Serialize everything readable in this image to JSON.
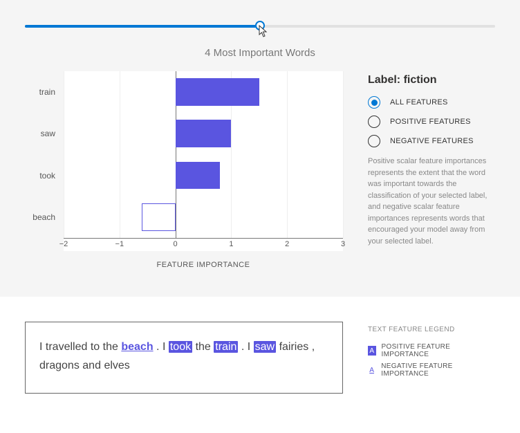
{
  "slider": {
    "percent": 50
  },
  "title": "4 Most Important Words",
  "chart_data": {
    "type": "bar",
    "orientation": "horizontal",
    "title": "4 Most Important Words",
    "xlabel": "FEATURE IMPORTANCE",
    "ylabel": "",
    "xlim": [
      -2,
      3
    ],
    "xticks": [
      -2,
      -1,
      0,
      1,
      2,
      3
    ],
    "categories": [
      "train",
      "saw",
      "took",
      "beach"
    ],
    "values": [
      1.5,
      1.0,
      0.8,
      -0.6
    ],
    "series": [
      {
        "name": "Feature Importance",
        "values": [
          1.5,
          1.0,
          0.8,
          -0.6
        ]
      }
    ]
  },
  "side": {
    "title": "Label: fiction",
    "options": [
      {
        "label": "ALL FEATURES",
        "selected": true
      },
      {
        "label": "POSITIVE FEATURES",
        "selected": false
      },
      {
        "label": "NEGATIVE FEATURES",
        "selected": false
      }
    ],
    "description": "Positive scalar feature importances represents the extent that the word was important towards the classification of your selected label, and negative scalar feature importances represents words that encouraged your model away from your selected label."
  },
  "sentence": {
    "tokens": [
      {
        "text": "I",
        "kind": "plain"
      },
      {
        "text": "travelled",
        "kind": "plain"
      },
      {
        "text": "to",
        "kind": "plain"
      },
      {
        "text": "the",
        "kind": "plain"
      },
      {
        "text": "beach",
        "kind": "neg"
      },
      {
        "text": ".",
        "kind": "plain"
      },
      {
        "text": "I",
        "kind": "plain"
      },
      {
        "text": "took",
        "kind": "pos"
      },
      {
        "text": "the",
        "kind": "plain"
      },
      {
        "text": "train",
        "kind": "pos"
      },
      {
        "text": ".",
        "kind": "plain"
      },
      {
        "text": "I",
        "kind": "plain"
      },
      {
        "text": "saw",
        "kind": "pos"
      },
      {
        "text": "fairies",
        "kind": "plain"
      },
      {
        "text": ",",
        "kind": "plain"
      },
      {
        "text": "dragons",
        "kind": "plain"
      },
      {
        "text": "and",
        "kind": "plain"
      },
      {
        "text": "elves",
        "kind": "plain"
      }
    ]
  },
  "legend": {
    "title": "TEXT FEATURE LEGEND",
    "pos_swatch_text": "A",
    "neg_swatch_text": "A",
    "pos": "POSITIVE FEATURE IMPORTANCE",
    "neg": "NEGATIVE FEATURE IMPORTANCE"
  },
  "axis_label": "FEATURE IMPORTANCE"
}
